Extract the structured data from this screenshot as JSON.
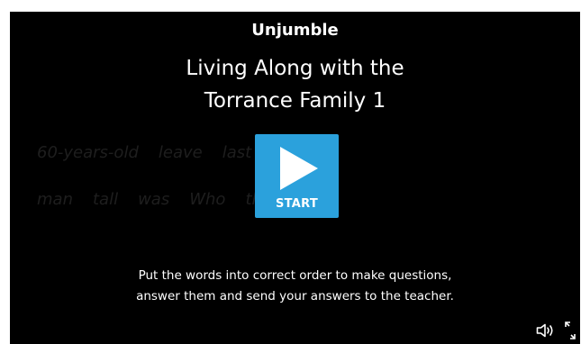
{
  "activity": {
    "type_label": "Unjumble",
    "title_line1": "Living Along with the",
    "title_line2": "Torrance Family 1"
  },
  "background_words": {
    "row1": [
      "60-years-old",
      "leave",
      "last"
    ],
    "row2": [
      "man",
      "tall",
      "was",
      "Who",
      "th"
    ]
  },
  "start_button": {
    "label": "START",
    "icon": "play-icon",
    "color": "#2ba1dc"
  },
  "instructions": {
    "line1": "Put the words into correct order to make questions,",
    "line2": "answer them and send your answers to the teacher."
  },
  "controls": {
    "sound_icon": "speaker-icon",
    "fullscreen_icon": "fullscreen-icon"
  },
  "colors": {
    "background": "#000000",
    "text": "#ffffff",
    "accent": "#2ba1dc"
  }
}
